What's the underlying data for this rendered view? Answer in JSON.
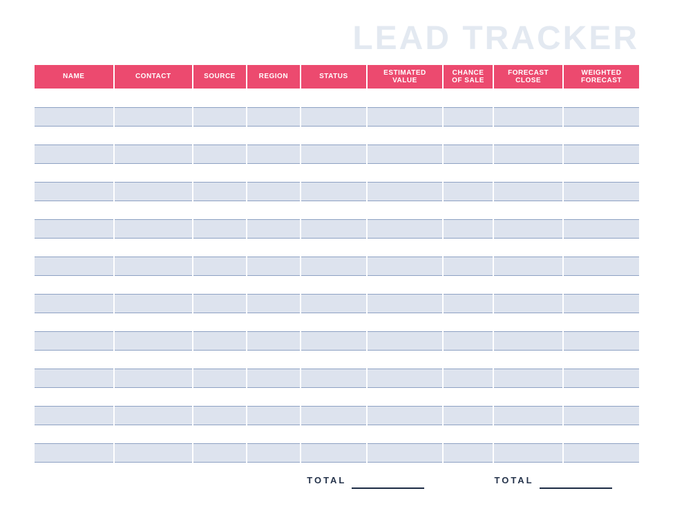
{
  "title": "LEAD TRACKER",
  "columns": [
    "NAME",
    "CONTACT",
    "SOURCE",
    "REGION",
    "STATUS",
    "ESTIMATED\nVALUE",
    "CHANCE\nOF SALE",
    "FORECAST\nCLOSE",
    "WEIGHTED\nFORECAST"
  ],
  "rows": [
    [
      "",
      "",
      "",
      "",
      "",
      "",
      "",
      "",
      ""
    ],
    [
      "",
      "",
      "",
      "",
      "",
      "",
      "",
      "",
      ""
    ],
    [
      "",
      "",
      "",
      "",
      "",
      "",
      "",
      "",
      ""
    ],
    [
      "",
      "",
      "",
      "",
      "",
      "",
      "",
      "",
      ""
    ],
    [
      "",
      "",
      "",
      "",
      "",
      "",
      "",
      "",
      ""
    ],
    [
      "",
      "",
      "",
      "",
      "",
      "",
      "",
      "",
      ""
    ],
    [
      "",
      "",
      "",
      "",
      "",
      "",
      "",
      "",
      ""
    ],
    [
      "",
      "",
      "",
      "",
      "",
      "",
      "",
      "",
      ""
    ],
    [
      "",
      "",
      "",
      "",
      "",
      "",
      "",
      "",
      ""
    ],
    [
      "",
      "",
      "",
      "",
      "",
      "",
      "",
      "",
      ""
    ],
    [
      "",
      "",
      "",
      "",
      "",
      "",
      "",
      "",
      ""
    ],
    [
      "",
      "",
      "",
      "",
      "",
      "",
      "",
      "",
      ""
    ],
    [
      "",
      "",
      "",
      "",
      "",
      "",
      "",
      "",
      ""
    ],
    [
      "",
      "",
      "",
      "",
      "",
      "",
      "",
      "",
      ""
    ],
    [
      "",
      "",
      "",
      "",
      "",
      "",
      "",
      "",
      ""
    ],
    [
      "",
      "",
      "",
      "",
      "",
      "",
      "",
      "",
      ""
    ],
    [
      "",
      "",
      "",
      "",
      "",
      "",
      "",
      "",
      ""
    ],
    [
      "",
      "",
      "",
      "",
      "",
      "",
      "",
      "",
      ""
    ],
    [
      "",
      "",
      "",
      "",
      "",
      "",
      "",
      "",
      ""
    ],
    [
      "",
      "",
      "",
      "",
      "",
      "",
      "",
      "",
      ""
    ]
  ],
  "totals": {
    "label1": "TOTAL",
    "value1": "",
    "label2": "TOTAL",
    "value2": ""
  }
}
